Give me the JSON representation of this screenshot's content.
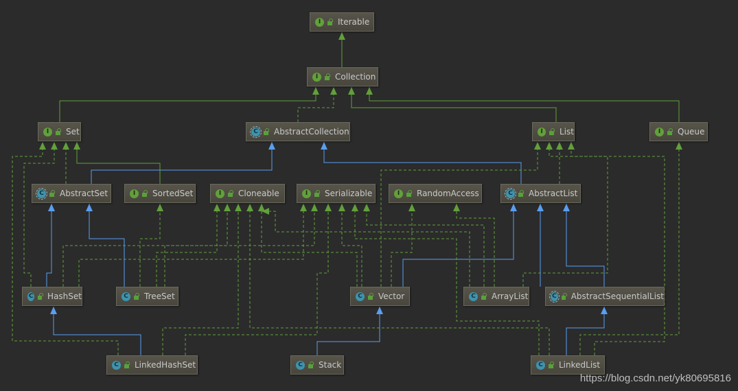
{
  "colors": {
    "background": "#2b2b2b",
    "interface_edge": "#62a03b",
    "class_edge": "#5a9ef0",
    "node_text": "#c9c9c9"
  },
  "icons": {
    "interface": "I",
    "class": "C",
    "abstract": "C"
  },
  "nodes": [
    {
      "id": "Iterable",
      "label": "Iterable",
      "kind": "interface"
    },
    {
      "id": "Collection",
      "label": "Collection",
      "kind": "interface"
    },
    {
      "id": "Set",
      "label": "Set",
      "kind": "interface"
    },
    {
      "id": "AbstractCollection",
      "label": "AbstractCollection",
      "kind": "abstract"
    },
    {
      "id": "List",
      "label": "List",
      "kind": "interface"
    },
    {
      "id": "Queue",
      "label": "Queue",
      "kind": "interface"
    },
    {
      "id": "AbstractSet",
      "label": "AbstractSet",
      "kind": "abstract"
    },
    {
      "id": "SortedSet",
      "label": "SortedSet",
      "kind": "interface"
    },
    {
      "id": "Cloneable",
      "label": "Cloneable",
      "kind": "interface"
    },
    {
      "id": "Serializable",
      "label": "Serializable",
      "kind": "interface"
    },
    {
      "id": "RandomAccess",
      "label": "RandomAccess",
      "kind": "interface"
    },
    {
      "id": "AbstractList",
      "label": "AbstractList",
      "kind": "abstract"
    },
    {
      "id": "HashSet",
      "label": "HashSet",
      "kind": "class"
    },
    {
      "id": "TreeSet",
      "label": "TreeSet",
      "kind": "class"
    },
    {
      "id": "Vector",
      "label": "Vector",
      "kind": "class"
    },
    {
      "id": "ArrayList",
      "label": "ArrayList",
      "kind": "class"
    },
    {
      "id": "AbstractSequentialList",
      "label": "AbstractSequentialList",
      "kind": "abstract"
    },
    {
      "id": "LinkedHashSet",
      "label": "LinkedHashSet",
      "kind": "class"
    },
    {
      "id": "Stack",
      "label": "Stack",
      "kind": "class"
    },
    {
      "id": "LinkedList",
      "label": "LinkedList",
      "kind": "class"
    }
  ],
  "edges": [
    {
      "from": "Collection",
      "to": "Iterable",
      "type": "extends-interface"
    },
    {
      "from": "Set",
      "to": "Collection",
      "type": "extends-interface"
    },
    {
      "from": "AbstractCollection",
      "to": "Collection",
      "type": "implements"
    },
    {
      "from": "List",
      "to": "Collection",
      "type": "extends-interface"
    },
    {
      "from": "Queue",
      "to": "Collection",
      "type": "extends-interface"
    },
    {
      "from": "AbstractSet",
      "to": "AbstractCollection",
      "type": "extends-class"
    },
    {
      "from": "AbstractList",
      "to": "AbstractCollection",
      "type": "extends-class"
    },
    {
      "from": "LinkedHashSet",
      "to": "Set",
      "type": "implements"
    },
    {
      "from": "HashSet",
      "to": "Set",
      "type": "implements"
    },
    {
      "from": "AbstractSet",
      "to": "Set",
      "type": "implements"
    },
    {
      "from": "SortedSet",
      "to": "Set",
      "type": "extends-interface"
    },
    {
      "from": "TreeSet",
      "to": "SortedSet",
      "type": "implements"
    },
    {
      "from": "HashSet",
      "to": "AbstractSet",
      "type": "extends-class"
    },
    {
      "from": "TreeSet",
      "to": "AbstractSet",
      "type": "extends-class"
    },
    {
      "from": "LinkedHashSet",
      "to": "HashSet",
      "type": "extends-class"
    },
    {
      "from": "Stack",
      "to": "Vector",
      "type": "extends-class"
    },
    {
      "from": "Vector",
      "to": "AbstractList",
      "type": "extends-class"
    },
    {
      "from": "ArrayList",
      "to": "AbstractList",
      "type": "extends-class"
    },
    {
      "from": "AbstractSequentialList",
      "to": "AbstractList",
      "type": "extends-class"
    },
    {
      "from": "LinkedList",
      "to": "AbstractSequentialList",
      "type": "extends-class"
    },
    {
      "from": "Vector",
      "to": "List",
      "type": "implements"
    },
    {
      "from": "ArrayList",
      "to": "List",
      "type": "implements"
    },
    {
      "from": "AbstractList",
      "to": "List",
      "type": "implements"
    },
    {
      "from": "LinkedList",
      "to": "List",
      "type": "implements"
    },
    {
      "from": "LinkedList",
      "to": "Queue",
      "type": "implements"
    },
    {
      "from": "HashSet",
      "to": "Cloneable",
      "type": "implements"
    },
    {
      "from": "HashSet",
      "to": "Serializable",
      "type": "implements"
    },
    {
      "from": "TreeSet",
      "to": "Cloneable",
      "type": "implements"
    },
    {
      "from": "TreeSet",
      "to": "Serializable",
      "type": "implements"
    },
    {
      "from": "LinkedHashSet",
      "to": "Cloneable",
      "type": "implements"
    },
    {
      "from": "LinkedHashSet",
      "to": "Serializable",
      "type": "implements"
    },
    {
      "from": "Vector",
      "to": "Cloneable",
      "type": "implements"
    },
    {
      "from": "Vector",
      "to": "Serializable",
      "type": "implements"
    },
    {
      "from": "Vector",
      "to": "RandomAccess",
      "type": "implements"
    },
    {
      "from": "ArrayList",
      "to": "Cloneable",
      "type": "implements"
    },
    {
      "from": "ArrayList",
      "to": "Serializable",
      "type": "implements"
    },
    {
      "from": "ArrayList",
      "to": "RandomAccess",
      "type": "implements"
    },
    {
      "from": "LinkedList",
      "to": "Cloneable",
      "type": "implements"
    },
    {
      "from": "LinkedList",
      "to": "Serializable",
      "type": "implements"
    }
  ],
  "watermark": "https://blog.csdn.net/yk80695816"
}
